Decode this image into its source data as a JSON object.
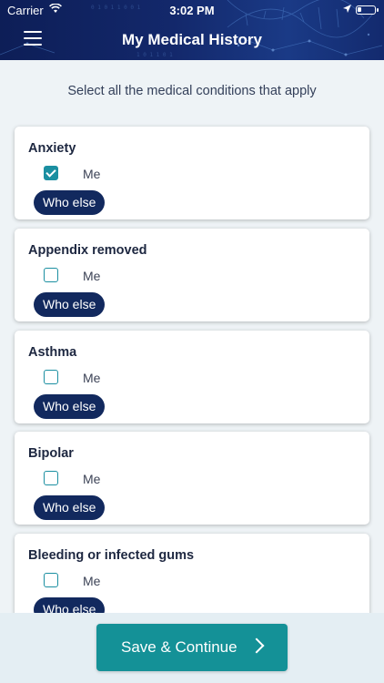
{
  "status_bar": {
    "carrier": "Carrier",
    "time": "3:02 PM"
  },
  "header": {
    "title": "My Medical History",
    "menu_icon": "hamburger-menu-icon"
  },
  "instruction": "Select all the medical conditions that apply",
  "conditions": [
    {
      "name": "Anxiety",
      "me_label": "Me",
      "me_checked": true,
      "who_else_label": "Who else"
    },
    {
      "name": "Appendix removed",
      "me_label": "Me",
      "me_checked": false,
      "who_else_label": "Who else"
    },
    {
      "name": "Asthma",
      "me_label": "Me",
      "me_checked": false,
      "who_else_label": "Who else"
    },
    {
      "name": "Bipolar",
      "me_label": "Me",
      "me_checked": false,
      "who_else_label": "Who else"
    },
    {
      "name": "Bleeding or infected gums",
      "me_label": "Me",
      "me_checked": false,
      "who_else_label": "Who else"
    }
  ],
  "footer": {
    "save_label": "Save & Continue"
  },
  "colors": {
    "header_bg": "#13286b",
    "accent_teal": "#149197",
    "button_navy": "#12295e",
    "checkbox": "#1b8fa1"
  }
}
